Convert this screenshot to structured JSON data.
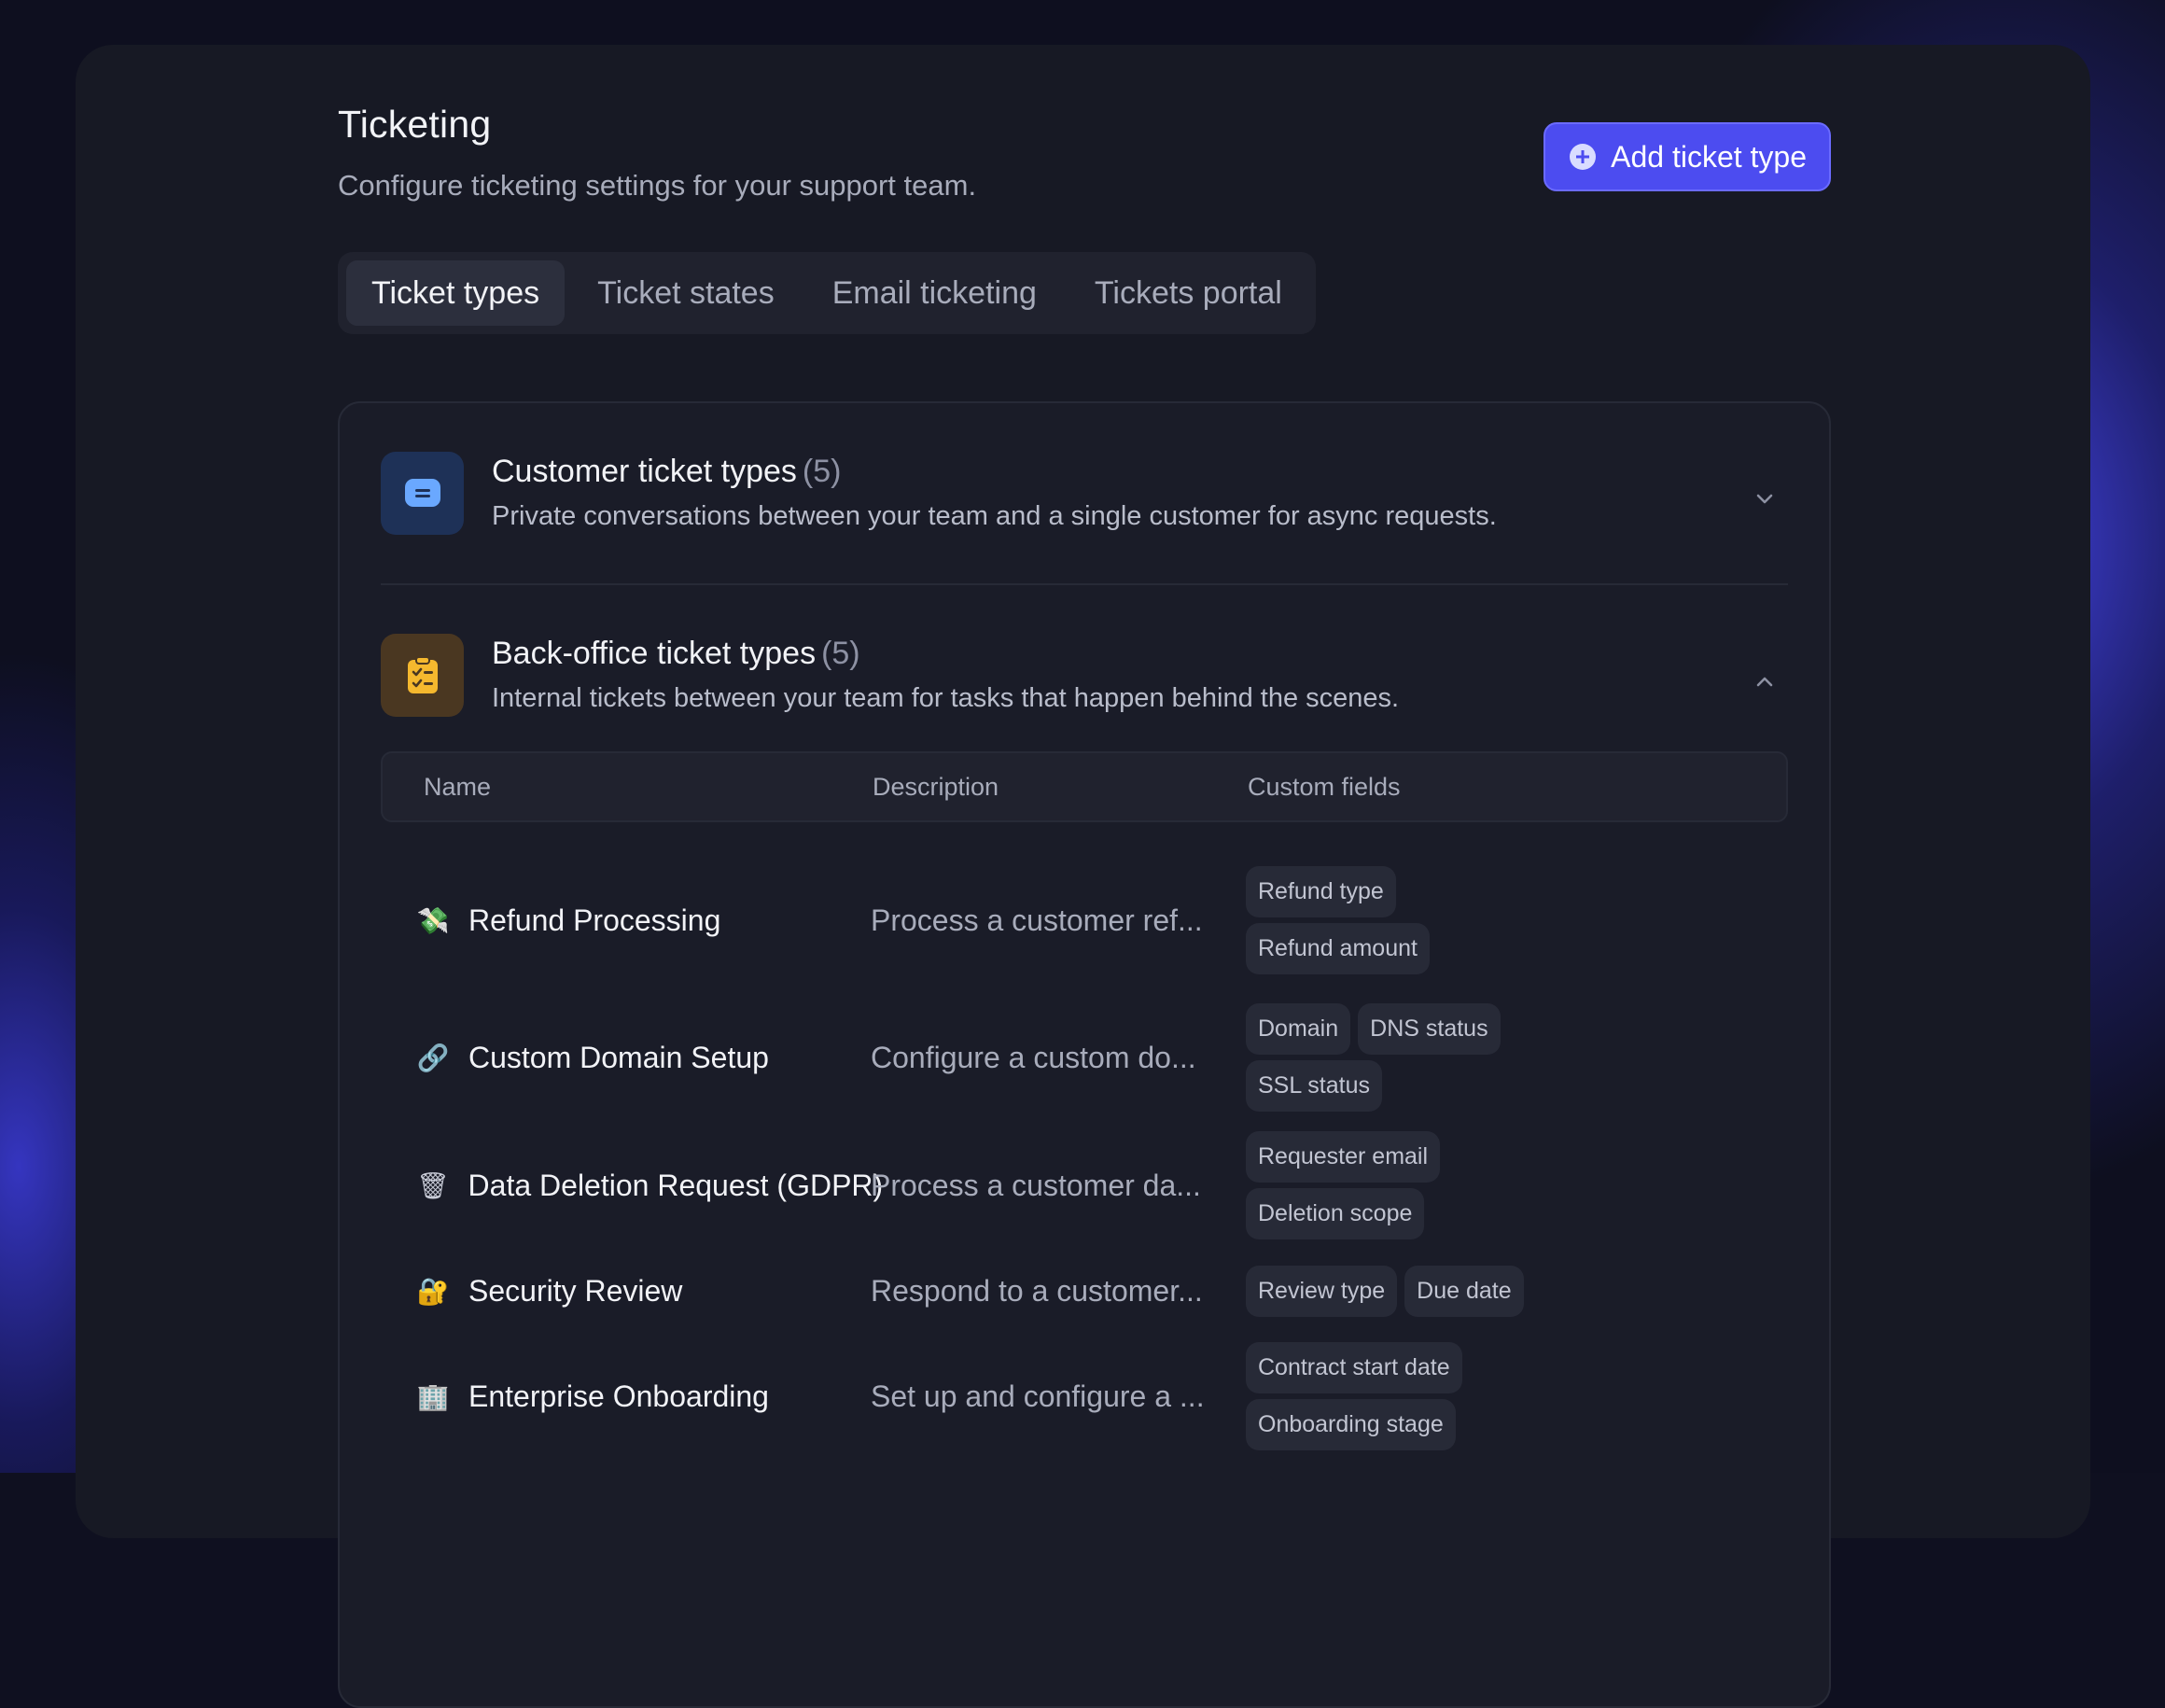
{
  "header": {
    "title": "Ticketing",
    "subtitle": "Configure ticketing settings for your support team.",
    "add_button": "Add ticket type"
  },
  "tabs": [
    {
      "label": "Ticket types",
      "active": true
    },
    {
      "label": "Ticket states",
      "active": false
    },
    {
      "label": "Email ticketing",
      "active": false
    },
    {
      "label": "Tickets portal",
      "active": false
    }
  ],
  "sections": {
    "customer": {
      "title": "Customer ticket types",
      "count": "(5)",
      "description": "Private conversations between your team and a single customer for async requests.",
      "icon": "chat-bubble-icon",
      "expanded": false
    },
    "backoffice": {
      "title": "Back-office ticket types",
      "count": "(5)",
      "description": "Internal tickets between your team for tasks that happen behind the scenes.",
      "icon": "clipboard-checklist-icon",
      "expanded": true
    }
  },
  "table": {
    "columns": [
      "Name",
      "Description",
      "Custom fields"
    ],
    "rows": [
      {
        "icon": "💸",
        "name": "Refund Processing",
        "description": "Process a customer ref...",
        "fields": [
          "Refund type",
          "Refund amount"
        ]
      },
      {
        "icon": "🔗",
        "name": "Custom Domain Setup",
        "description": "Configure a custom do...",
        "fields": [
          "Domain",
          "DNS status",
          "SSL status"
        ]
      },
      {
        "icon": "🗑",
        "name": "Data Deletion Request (GDPR)",
        "description": "Process a customer da...",
        "fields": [
          "Requester email",
          "Deletion scope"
        ]
      },
      {
        "icon": "🔐",
        "name": "Security Review",
        "description": "Respond to a customer...",
        "fields": [
          "Review type",
          "Due date"
        ]
      },
      {
        "icon": "🏢",
        "name": "Enterprise Onboarding",
        "description": "Set up and configure a ...",
        "fields": [
          "Contract start date",
          "Onboarding stage"
        ]
      }
    ]
  },
  "colors": {
    "accent": "#4c4cf0",
    "panel": "#171924",
    "customer_icon_bg": "#1e3157",
    "backoffice_icon_bg": "#4a3721",
    "backoffice_icon_fg": "#f5b82e"
  }
}
